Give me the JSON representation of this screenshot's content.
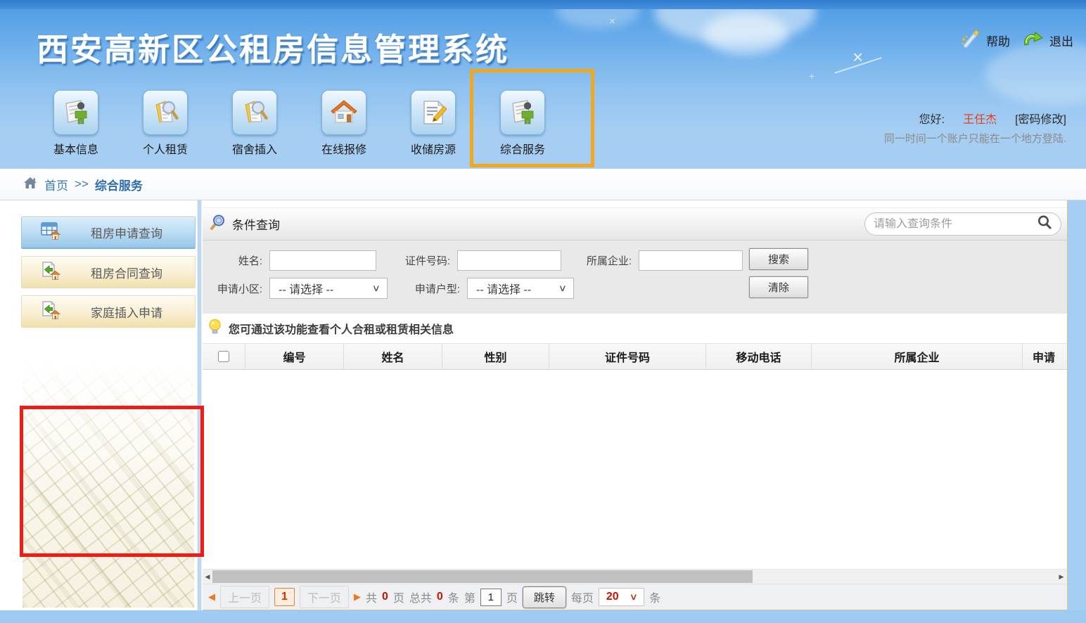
{
  "header": {
    "title": "西安高新区公租房信息管理系统",
    "help_label": "帮助",
    "logout_label": "退出",
    "nav_items": [
      {
        "label": "基本信息",
        "icon": "person-doc-icon"
      },
      {
        "label": "个人租赁",
        "icon": "doc-search-icon"
      },
      {
        "label": "宿舍插入",
        "icon": "doc-search-icon"
      },
      {
        "label": "在线报修",
        "icon": "house-icon"
      },
      {
        "label": "收储房源",
        "icon": "doc-pencil-icon"
      },
      {
        "label": "综合服务",
        "icon": "person-doc-icon",
        "highlighted": true
      }
    ],
    "greeting_label": "您好:",
    "username": "王任杰",
    "change_password_label": "[密码修改]",
    "login_notice": "同一时间一个账户只能在一个地方登陆."
  },
  "breadcrumb": {
    "home": "首页",
    "separator": ">>",
    "current": "综合服务"
  },
  "sidebar": {
    "items": [
      {
        "label": "租房申请查询",
        "active": true
      },
      {
        "label": "租房合同查询",
        "active": false
      },
      {
        "label": "家庭插入申请",
        "active": false
      }
    ]
  },
  "query_panel": {
    "title": "条件查询",
    "quick_search_placeholder": "请输入查询条件",
    "fields": {
      "name_label": "姓名:",
      "id_label": "证件号码:",
      "company_label": "所属企业:",
      "community_label": "申请小区:",
      "unit_type_label": "申请户型:",
      "select_placeholder": "-- 请选择 --"
    },
    "search_button": "搜索",
    "clear_button": "清除",
    "tip": "您可通过该功能查看个人合租或租赁相关信息"
  },
  "table": {
    "columns": [
      "编号",
      "姓名",
      "性别",
      "证件号码",
      "移动电话",
      "所属企业",
      "申请"
    ],
    "rows": []
  },
  "pagination": {
    "prev": "上一页",
    "page": "1",
    "next": "下一页",
    "total_pages_prefix": "共",
    "total_pages": "0",
    "pages_suffix": "页",
    "total_items_prefix": "总共",
    "total_items": "0",
    "items_suffix": "条",
    "goto_prefix": "第",
    "goto_value": "1",
    "goto_suffix": "页",
    "jump_button": "跳转",
    "per_page_prefix": "每页",
    "per_page": "20",
    "per_page_suffix": "条"
  },
  "colors": {
    "header_blue": "#4d9be4",
    "annotation_red": "#ee1c14",
    "annotation_orange": "#f2a71c",
    "active_menu_blue": "#97c7ea",
    "menu_cream": "#f1dfab",
    "username_red": "#e0401c",
    "pagination_value_red": "#cc1100"
  }
}
